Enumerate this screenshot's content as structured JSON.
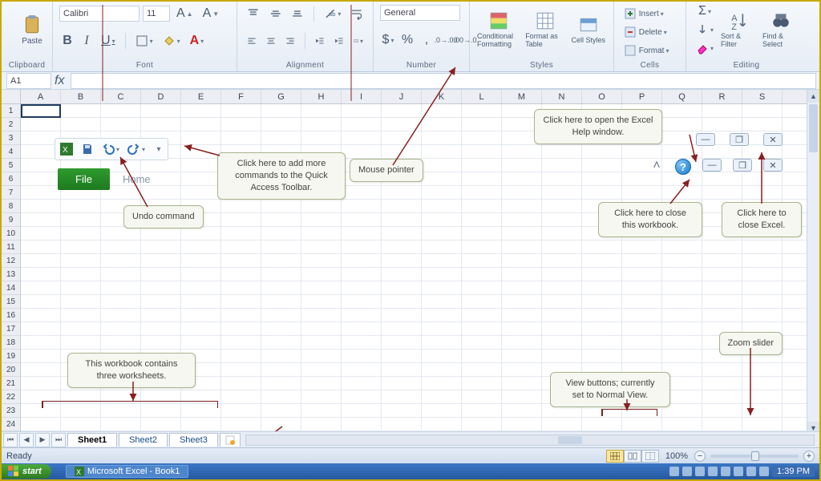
{
  "ribbon": {
    "clipboard": {
      "label": "Clipboard",
      "paste": "Paste"
    },
    "font": {
      "label": "Font",
      "name": "Calibri",
      "size": "11"
    },
    "alignment": {
      "label": "Alignment"
    },
    "number": {
      "label": "Number",
      "format": "General"
    },
    "styles": {
      "label": "Styles",
      "conditional": "Conditional Formatting",
      "table": "Format as Table",
      "cell": "Cell Styles"
    },
    "cells_grp": {
      "label": "Cells",
      "insert": "Insert",
      "delete": "Delete",
      "format": "Format"
    },
    "editing": {
      "label": "Editing",
      "sort": "Sort & Filter",
      "find": "Find & Select"
    }
  },
  "namebox": "A1",
  "columns": [
    "A",
    "B",
    "C",
    "D",
    "E",
    "F",
    "G",
    "H",
    "I",
    "J",
    "K",
    "L",
    "M",
    "N",
    "O",
    "P",
    "Q",
    "R",
    "S"
  ],
  "rows": [
    "1",
    "2",
    "3",
    "4",
    "5",
    "6",
    "7",
    "8",
    "9",
    "10",
    "11",
    "12",
    "13",
    "14",
    "15",
    "16",
    "17",
    "18",
    "19",
    "20",
    "21",
    "22",
    "23",
    "24"
  ],
  "file_tab": "File",
  "home_tab": "Home",
  "callouts": {
    "qat": "Click here to add more commands to the Quick Access Toolbar.",
    "undo": "Undo command",
    "mouse": "Mouse pointer",
    "help": "Click here to open the Excel Help window.",
    "close_wb": "Click here to close this workbook.",
    "close_excel": "Click here to close Excel.",
    "sheets": "This workbook contains three worksheets.",
    "views": "View buttons; currently set to Normal View.",
    "zoom": "Zoom slider"
  },
  "sheets": {
    "s1": "Sheet1",
    "s2": "Sheet2",
    "s3": "Sheet3"
  },
  "status": {
    "ready": "Ready",
    "zoom": "100%"
  },
  "taskbar": {
    "start": "start",
    "app": "Microsoft Excel - Book1",
    "clock": "1:39 PM"
  },
  "colors": {
    "accent_green": "#2e9a2e",
    "arrow": "#8a1f1f"
  }
}
